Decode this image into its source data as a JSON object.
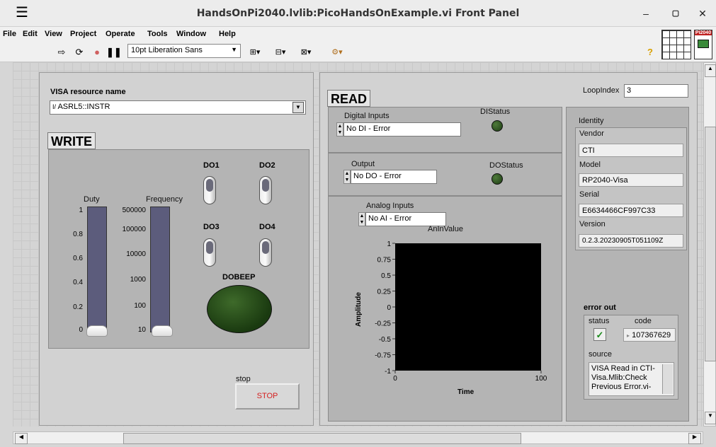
{
  "window": {
    "title": "HandsOnPi2040.lvlib:PicoHandsOnExample.vi Front Panel",
    "minimize": "–",
    "maximize": "▢",
    "close": "✕"
  },
  "menu": [
    "File",
    "Edit",
    "View",
    "Project",
    "Operate",
    "Tools",
    "Window",
    "Help"
  ],
  "toolbar": {
    "font": "10pt Liberation Sans",
    "badge": "Pi2040"
  },
  "visa": {
    "label": "VISA resource name",
    "value": "ASRL5::INSTR"
  },
  "write": {
    "header": "WRITE",
    "duty_label": "Duty",
    "duty_ticks": [
      "1",
      "0.8",
      "0.6",
      "0.4",
      "0.2",
      "0"
    ],
    "duty_value": 0,
    "freq_label": "Frequency",
    "freq_ticks": [
      "500000",
      "100000",
      "10000",
      "1000",
      "100",
      "10"
    ],
    "freq_value": 10,
    "do1": "DO1",
    "do2": "DO2",
    "do3": "DO3",
    "do4": "DO4",
    "dobeep": "DOBEEP"
  },
  "stop": {
    "label": "stop",
    "button": "STOP"
  },
  "read": {
    "header": "READ",
    "loopindex_label": "LoopIndex",
    "loopindex_value": "3",
    "di_label": "Digital Inputs",
    "di_value": "No DI - Error",
    "distatus": "DIStatus",
    "output_label": "Output",
    "output_value": "No DO - Error",
    "dostatus": "DOStatus",
    "ai_label": "Analog Inputs",
    "ai_value": "No AI - Error"
  },
  "chart_data": {
    "type": "line",
    "title": "AnInValue",
    "xlabel": "Time",
    "ylabel": "Amplitude",
    "xlim": [
      0,
      100
    ],
    "ylim": [
      -1,
      1
    ],
    "x_ticks": [
      "0",
      "100"
    ],
    "y_ticks": [
      "1",
      "0.75",
      "0.5",
      "0.25",
      "0",
      "-0.25",
      "-0.5",
      "-0.75",
      "-1"
    ],
    "series": []
  },
  "identity": {
    "label": "Identity",
    "vendor_label": "Vendor",
    "vendor": "CTI",
    "model_label": "Model",
    "model": "RP2040-Visa",
    "serial_label": "Serial",
    "serial": "E6634466CF997C33",
    "version_label": "Version",
    "version": "0.2.3.20230905T051109Z"
  },
  "error": {
    "label": "error out",
    "status_label": "status",
    "code_label": "code",
    "code": "107367629",
    "source_label": "source",
    "source_lines": [
      "VISA Read in CTI-",
      "Visa.Mlib:Check",
      "Previous Error.vi-"
    ]
  },
  "colors": {
    "led_off": "#1e3d14",
    "chart_bg": "#000000",
    "stop_text": "#d42020",
    "slider_fill": "#5c5c7c"
  }
}
